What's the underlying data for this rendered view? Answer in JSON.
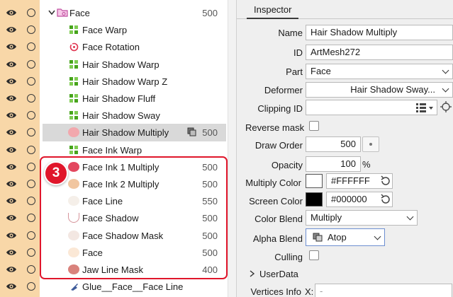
{
  "tree": {
    "rows": [
      {
        "label": "Face",
        "value": "500",
        "icon": "folder-icon"
      },
      {
        "label": "Face Warp",
        "value": "",
        "icon": "warp-deformer-icon"
      },
      {
        "label": "Face Rotation",
        "value": "",
        "icon": "rotation-deformer-icon"
      },
      {
        "label": "Hair Shadow Warp",
        "value": "",
        "icon": "warp-deformer-icon"
      },
      {
        "label": "Hair Shadow Warp Z",
        "value": "",
        "icon": "warp-deformer-icon"
      },
      {
        "label": "Hair Shadow Fluff",
        "value": "",
        "icon": "warp-deformer-icon"
      },
      {
        "label": "Hair Shadow Sway",
        "value": "",
        "icon": "warp-deformer-icon"
      },
      {
        "label": "Hair Shadow Multiply",
        "value": "500",
        "icon": "artmesh-thumbnail-icon"
      },
      {
        "label": "Face Ink Warp",
        "value": "",
        "icon": "warp-deformer-icon"
      },
      {
        "label": "Face Ink 1 Multiply",
        "value": "500",
        "icon": "artmesh-thumbnail-icon"
      },
      {
        "label": "Face Ink 2 Multiply",
        "value": "500",
        "icon": "artmesh-thumbnail-icon"
      },
      {
        "label": "Face Line",
        "value": "550",
        "icon": "artmesh-thumbnail-icon"
      },
      {
        "label": "Face Shadow",
        "value": "500",
        "icon": "artmesh-thumbnail-icon"
      },
      {
        "label": "Face Shadow Mask",
        "value": "500",
        "icon": "artmesh-thumbnail-icon"
      },
      {
        "label": "Face",
        "value": "500",
        "icon": "artmesh-thumbnail-icon"
      },
      {
        "label": "Jaw Line Mask",
        "value": "400",
        "icon": "artmesh-thumbnail-icon"
      },
      {
        "label": "Glue__Face__Face Line",
        "value": "",
        "icon": "glue-icon"
      }
    ],
    "badge_number": "3"
  },
  "inspector": {
    "tab_label": "Inspector",
    "name_label": "Name",
    "name_value": "Hair Shadow Multiply",
    "id_label": "ID",
    "id_value": "ArtMesh272",
    "part_label": "Part",
    "part_value": "Face",
    "deformer_label": "Deformer",
    "deformer_value": "Hair Shadow Sway...",
    "clipping_label": "Clipping ID",
    "clipping_value": "",
    "reverse_mask_label": "Reverse mask",
    "draw_order_label": "Draw Order",
    "draw_order_value": "500",
    "opacity_label": "Opacity",
    "opacity_value": "100",
    "opacity_unit": "%",
    "multiply_color_label": "Multiply Color",
    "multiply_color_value": "#FFFFFF",
    "screen_color_label": "Screen Color",
    "screen_color_value": "#000000",
    "color_blend_label": "Color Blend",
    "color_blend_value": "Multiply",
    "alpha_blend_label": "Alpha Blend",
    "alpha_blend_value": "Atop",
    "culling_label": "Culling",
    "userdata_label": "UserData",
    "vertices_label": "Vertices Info",
    "vertices_x_label": "X:",
    "vertices_x_value": "-"
  },
  "colors": {
    "highlight": "#e0162b",
    "visibility_strip": "#f8d7a8",
    "warp_green": "#47a41c",
    "selected_row": "#d9d9d9"
  }
}
